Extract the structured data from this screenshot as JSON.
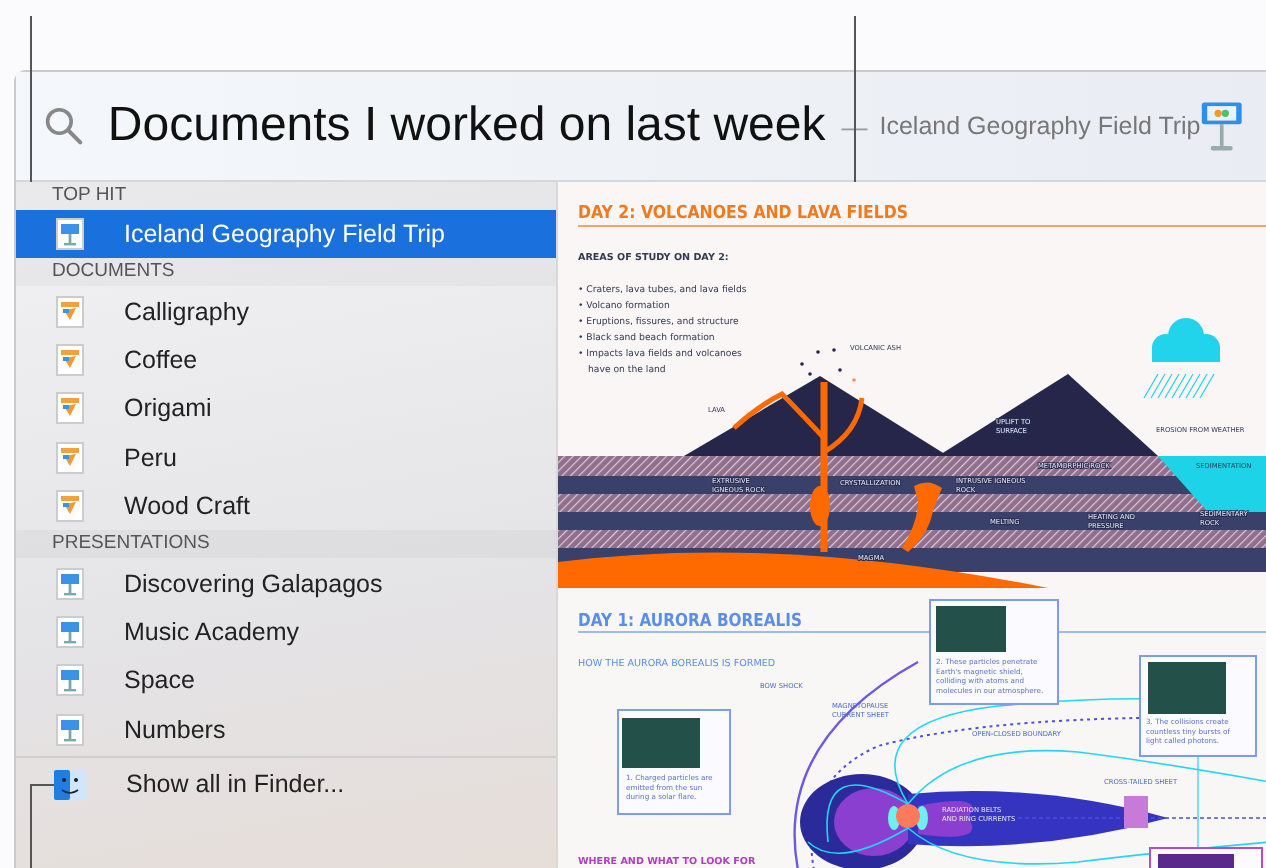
{
  "search": {
    "query": "Documents I worked on last week",
    "separator": "—",
    "suggestion": "Iceland Geography Field Trip"
  },
  "sections": [
    {
      "title": "TOP HIT",
      "items": [
        {
          "label": "Iceland Geography Field Trip",
          "kind": "keynote",
          "selected": true
        }
      ]
    },
    {
      "title": "DOCUMENTS",
      "items": [
        {
          "label": "Calligraphy",
          "kind": "pages",
          "selected": false
        },
        {
          "label": "Coffee",
          "kind": "pages",
          "selected": false
        },
        {
          "label": "Origami",
          "kind": "pages",
          "selected": false
        },
        {
          "label": "Peru",
          "kind": "pages",
          "selected": false
        },
        {
          "label": "Wood Craft",
          "kind": "pages",
          "selected": false
        }
      ]
    },
    {
      "title": "PRESENTATIONS",
      "items": [
        {
          "label": "Discovering Galapagos",
          "kind": "keynote",
          "selected": false
        },
        {
          "label": "Music Academy",
          "kind": "keynote",
          "selected": false
        },
        {
          "label": "Space",
          "kind": "keynote",
          "selected": false
        },
        {
          "label": "Numbers",
          "kind": "keynote",
          "selected": false
        }
      ]
    }
  ],
  "footer": {
    "label": "Show all in Finder..."
  },
  "preview": {
    "volcano": {
      "title": "DAY 2: VOLCANOES AND LAVA FIELDS",
      "subtitle": "AREAS OF STUDY ON DAY 2:",
      "bullets": [
        [
          "• Craters, lava tubes, and lava fields"
        ],
        [
          "• Volcano formation"
        ],
        [
          "• Eruptions, fissures, and structure"
        ],
        [
          "• Black sand beach formation"
        ],
        [
          "• Impacts lava fields and volcanoes",
          "have on the land"
        ]
      ],
      "labels": [
        [
          "VOLCANIC ASH"
        ],
        [
          "LAVA"
        ],
        [
          "UPLIFT TO",
          "SURFACE"
        ],
        [
          "EROSION FROM WEATHER"
        ],
        [
          "SEDIMENTATION"
        ],
        [
          "EXTRUSIVE",
          "IGNEOUS ROCK"
        ],
        [
          "CRYSTALLIZATION"
        ],
        [
          "INTRUSIVE IGNEOUS",
          "ROCK"
        ],
        [
          "METAMORPHIC ROCK"
        ],
        [
          "MELTING"
        ],
        [
          "HEATING AND",
          "PRESSURE"
        ],
        [
          "SEDIMENTARY",
          "ROCK"
        ],
        [
          "MAGMA"
        ]
      ]
    },
    "aurora": {
      "title": "DAY 1: AURORA BOREALIS",
      "subtitle": "HOW THE AURORA BOREALIS IS FORMED",
      "labels": [
        [
          "BOW SHOCK"
        ],
        [
          "MAGNETOPAUSE",
          "CURRENT SHEET"
        ],
        [
          "OPEN-CLOSED BOUNDARY"
        ],
        [
          "CROSS-TAILED SHEET"
        ],
        [
          "RADIATION BELTS",
          "AND RING CURRENTS"
        ]
      ],
      "cards": [
        {
          "caption_lines": [
            "1. Charged particles are",
            "emitted from the sun",
            "during a solar flare."
          ]
        },
        {
          "caption_lines": [
            "2. These particles penetrate",
            "Earth's magnetic shield,",
            "colliding with atoms and",
            "molecules in our atmosphere."
          ]
        },
        {
          "caption_lines": [
            "3. The collisions create",
            "countless tiny bursts of",
            "light called photons."
          ]
        }
      ],
      "footer_heading": "WHERE AND WHAT TO LOOK FOR"
    }
  }
}
